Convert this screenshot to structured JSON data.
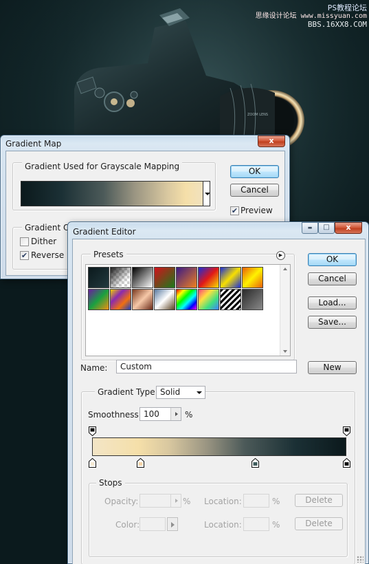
{
  "watermark": {
    "line1": "思缘设计论坛 www.missyuan.com",
    "line2": "PS教程论坛",
    "line3": "BBS.16XX8.COM"
  },
  "camera": {
    "lens_text": "ZOOM LENS"
  },
  "gradient_map": {
    "title": "Gradient Map",
    "close_glyph": "x",
    "section_label": "Gradient Used for Grayscale Mapping",
    "options_label": "Gradient Options",
    "ok_label": "OK",
    "cancel_label": "Cancel",
    "preview_label": "Preview",
    "preview_checked": true,
    "dither_label": "Dither",
    "dither_checked": false,
    "reverse_label": "Reverse",
    "reverse_checked": true
  },
  "gradient_editor": {
    "title": "Gradient Editor",
    "minimize_glyph": "▬",
    "maximize_glyph": "□",
    "close_glyph": "x",
    "presets_label": "Presets",
    "presets_menu_glyph": "▶",
    "ok_label": "OK",
    "cancel_label": "Cancel",
    "load_label": "Load...",
    "save_label": "Save...",
    "name_label": "Name:",
    "name_value": "Custom",
    "new_label": "New",
    "gradient_type_label": "Gradient Type:",
    "gradient_type_value": "Solid",
    "smoothness_label": "Smoothness:",
    "smoothness_value": "100",
    "smoothness_unit": "%",
    "stops_label": "Stops",
    "opacity_label": "Opacity:",
    "color_label": "Color:",
    "location_label": "Location:",
    "percent": "%",
    "delete_label": "Delete",
    "presets": [
      {
        "name": "foreground-to-background",
        "colors": [
          "#0b191c",
          "#22393e"
        ]
      },
      {
        "name": "foreground-to-transparent",
        "colors": [
          "#888888",
          "#d8d8d8"
        ]
      },
      {
        "name": "black-white",
        "colors": [
          "#000000",
          "#ffffff"
        ]
      },
      {
        "name": "red-green",
        "colors": [
          "#d2121c",
          "#1a7a1a"
        ]
      },
      {
        "name": "violet-orange",
        "colors": [
          "#3a1b86",
          "#f08020"
        ]
      },
      {
        "name": "blue-red-yellow",
        "colors": [
          "#1a2ed8",
          "#e01818",
          "#f8e000"
        ]
      },
      {
        "name": "blue-yellow-blue",
        "colors": [
          "#1a2ed8",
          "#f8e000",
          "#1a2ed8"
        ]
      },
      {
        "name": "orange-yellow-orange",
        "colors": [
          "#e8600a",
          "#fff200",
          "#e8600a"
        ]
      },
      {
        "name": "violet-green-orange",
        "colors": [
          "#6a1ea0",
          "#1aa040",
          "#f09010"
        ]
      },
      {
        "name": "yellow-violet-orange-blue",
        "colors": [
          "#f0d000",
          "#8a2ab0",
          "#f07010",
          "#1a40c0"
        ]
      },
      {
        "name": "copper",
        "colors": [
          "#7a3a20",
          "#f6c8a8",
          "#6a2a18"
        ]
      },
      {
        "name": "chrome",
        "colors": [
          "#5a7aa0",
          "#ffffff",
          "#5a4020"
        ]
      },
      {
        "name": "spectrum",
        "colors": [
          "#ff0000",
          "#ffff00",
          "#00ff00",
          "#00ffff",
          "#0000ff",
          "#ff00ff"
        ]
      },
      {
        "name": "transparent-rainbow",
        "colors": [
          "#ff4080",
          "#ffe040",
          "#40e080",
          "#4080ff"
        ]
      },
      {
        "name": "transparent-stripes",
        "colors": [
          "#000000",
          "#ffffff"
        ]
      },
      {
        "name": "neutral-density",
        "colors": [
          "#2a2a2a",
          "#8a8a8a"
        ]
      }
    ],
    "stops": {
      "top": [
        {
          "location": 0,
          "color": "#111111"
        },
        {
          "location": 100,
          "color": "#111111"
        }
      ],
      "bottom": [
        {
          "location": 0,
          "color": "#f6ead2"
        },
        {
          "location": 19,
          "color": "#f5d3a8"
        },
        {
          "location": 64,
          "color": "#3f5c5c"
        },
        {
          "location": 100,
          "color": "#111111"
        }
      ]
    }
  }
}
